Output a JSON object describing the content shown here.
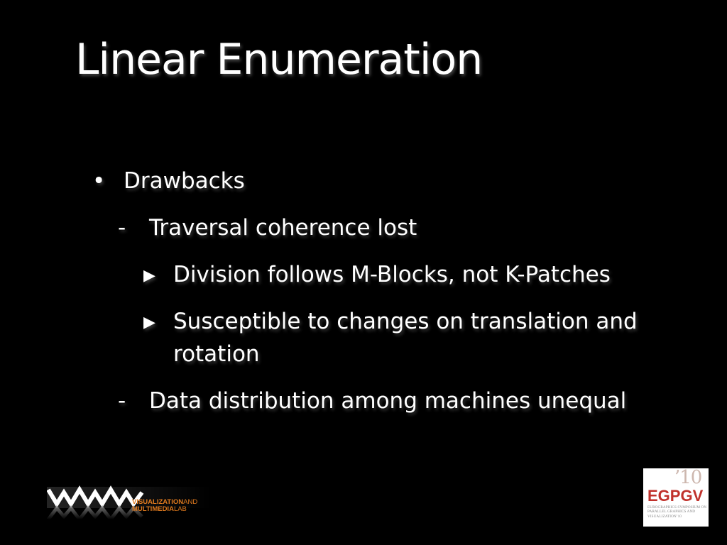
{
  "slide": {
    "title": "Linear Enumeration",
    "bullets": [
      {
        "marker": "•",
        "text": "Drawbacks"
      },
      {
        "marker": "-",
        "text": "Traversal coherence lost"
      },
      {
        "marker": "▶",
        "text": "Division follows M-Blocks, not K-Patches"
      },
      {
        "marker": "▶",
        "text": "Susceptible to changes on translation and",
        "text2": "rotation"
      },
      {
        "marker": "-",
        "text": "Data distribution among machines unequal"
      }
    ]
  },
  "logos": {
    "vml": {
      "line1_bold": "VISUALIZATION",
      "line1_thin": "AND",
      "line2_bold": "MULTIMEDIA",
      "line2_thin": "LAB"
    },
    "egpgv": {
      "year": "’10",
      "name": "EGPGV",
      "subtitle": "Eurographics Symposium on Parallel Graphics and Visualization’10"
    }
  },
  "colors": {
    "background": "#000000",
    "text": "#ffffff",
    "vml_accent": "#e07a1e",
    "egpgv_red": "#c0312b"
  }
}
